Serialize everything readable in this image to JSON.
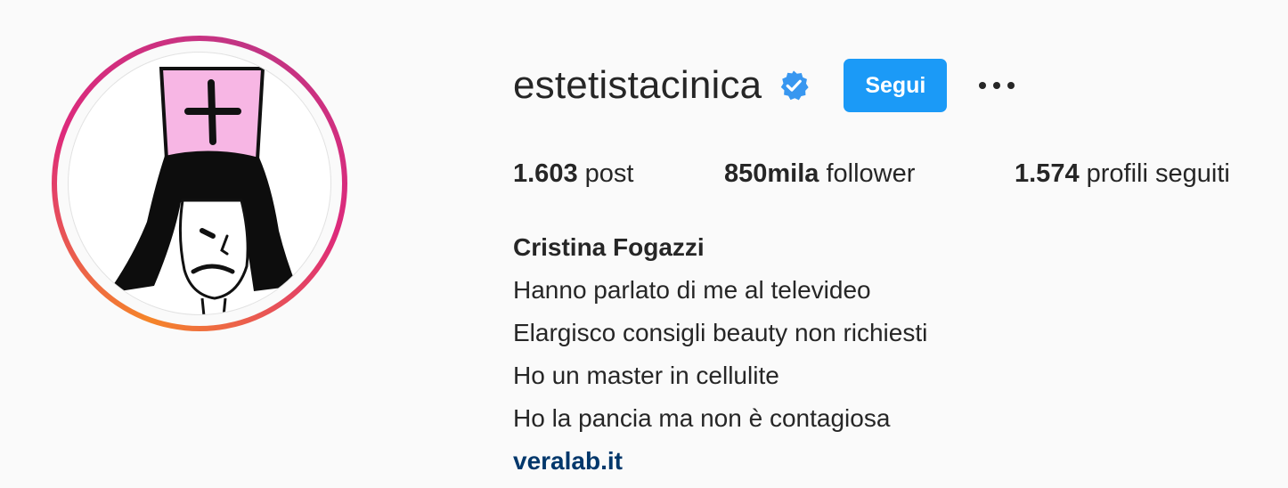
{
  "profile": {
    "username": "estetistacinica",
    "verified": true,
    "follow_label": "Segui",
    "more_label": "•••",
    "stats": {
      "posts_count": "1.603",
      "posts_label": "post",
      "followers_count": "850mila",
      "followers_label": "follower",
      "following_count": "1.574",
      "following_label": "profili seguiti"
    },
    "bio": {
      "full_name": "Cristina Fogazzi",
      "lines": [
        "Hanno parlato di me al televideo",
        "Elargisco consigli beauty non richiesti",
        "Ho un master in cellulite",
        "Ho la pancia ma non è contagiosa"
      ],
      "link": "veralab.it"
    }
  },
  "icons": {
    "verified": "verified-badge-icon",
    "more": "more-options-icon",
    "avatar": "nun-illustration"
  },
  "colors": {
    "background": "#fafafa",
    "text": "#262626",
    "follow_button": "#1b9af7",
    "verified_badge": "#3897f0",
    "link": "#00376b",
    "ring_start": "#f58529",
    "ring_end": "#c13584"
  }
}
